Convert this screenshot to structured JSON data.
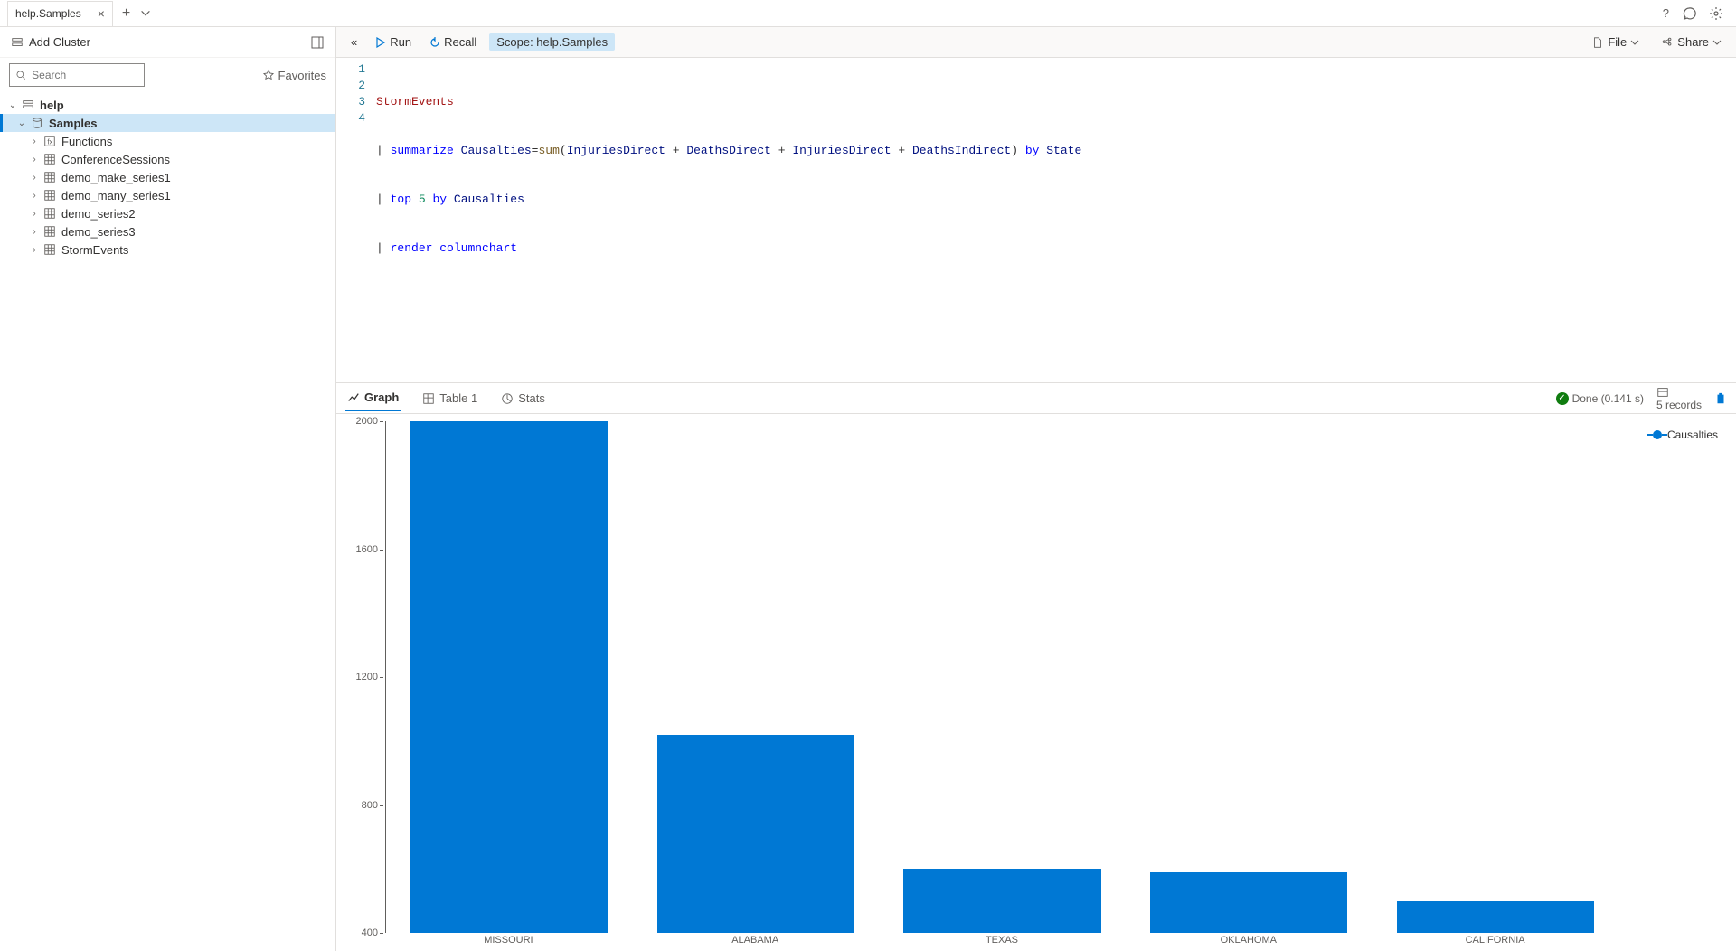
{
  "tab": {
    "title": "help.Samples"
  },
  "sidebar": {
    "add_cluster": "Add Cluster",
    "search_placeholder": "Search",
    "favorites": "Favorites",
    "nodes": {
      "help": "help",
      "samples": "Samples",
      "items": [
        "Functions",
        "ConferenceSessions",
        "demo_make_series1",
        "demo_many_series1",
        "demo_series2",
        "demo_series3",
        "StormEvents"
      ]
    }
  },
  "toolbar": {
    "run": "Run",
    "recall": "Recall",
    "scope": "Scope: help.Samples",
    "file": "File",
    "share": "Share"
  },
  "editor": {
    "lines": [
      "1",
      "2",
      "3",
      "4"
    ],
    "l1": {
      "a": "StormEvents"
    },
    "l2": {
      "pipe": "|",
      "kw": "summarize",
      "fld": "Causalties",
      "eq": "=",
      "fn": "sum",
      "open": "(",
      "f1": "InjuriesDirect",
      "p": " + ",
      "f2": "DeathsDirect",
      "f3": "InjuriesDirect",
      "f4": "DeathsIndirect",
      "close": ")",
      "by": "by",
      "state": "State"
    },
    "l3": {
      "pipe": "|",
      "kw": "top",
      "n": "5",
      "by": "by",
      "fld": "Causalties"
    },
    "l4": {
      "pipe": "|",
      "kw": "render",
      "arg": "columnchart"
    }
  },
  "results": {
    "tabs": {
      "graph": "Graph",
      "table": "Table 1",
      "stats": "Stats"
    },
    "status": "Done (0.141 s)",
    "records": "5 records"
  },
  "chart_data": {
    "type": "bar",
    "categories": [
      "MISSOURI",
      "ALABAMA",
      "TEXAS",
      "OKLAHOMA",
      "CALIFORNIA"
    ],
    "values": [
      2000,
      1020,
      600,
      590,
      500
    ],
    "series_name": "Causalties",
    "ylim": [
      400,
      2000
    ],
    "yticks": [
      400,
      800,
      1200,
      1600,
      2000
    ]
  }
}
